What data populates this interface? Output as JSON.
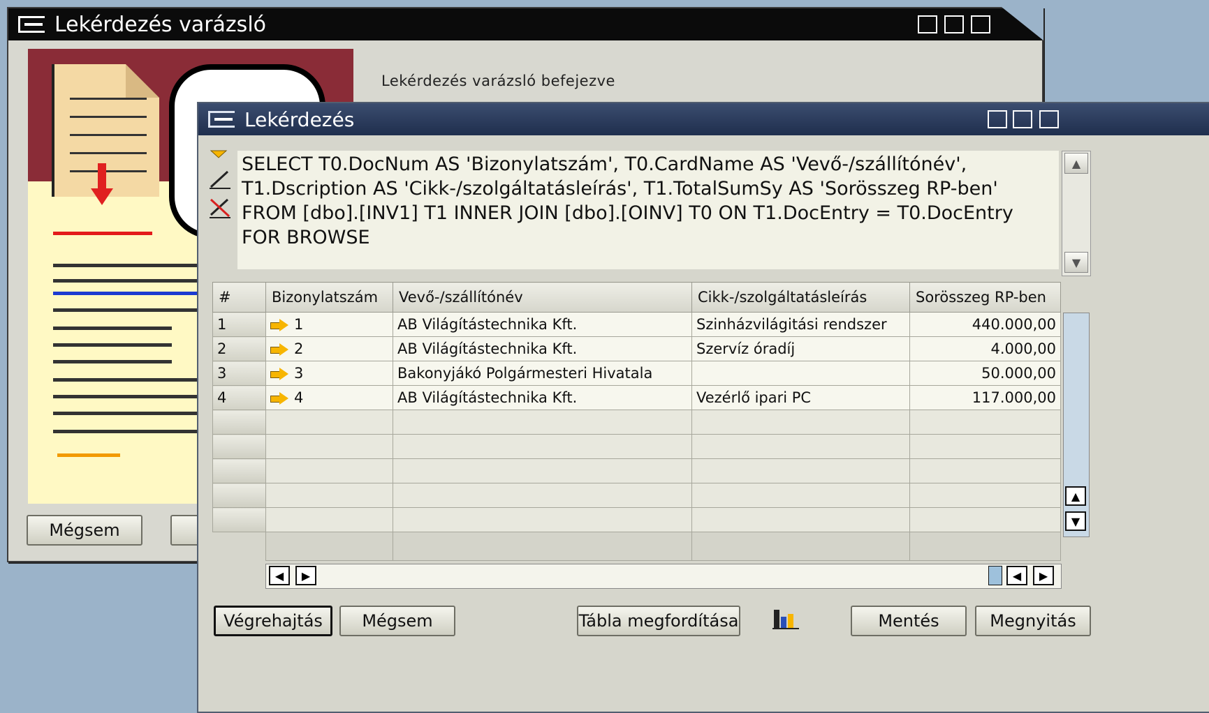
{
  "wizard": {
    "title": "Lekérdezés varázsló",
    "status_text": "Lekérdezés varázsló befejezve",
    "cancel_button": "Mégsem"
  },
  "query": {
    "title": "Lekérdezés",
    "sql": "SELECT T0.DocNum AS 'Bizonylatszám', T0.CardName AS 'Vevő-/szállítónév', T1.Dscription AS 'Cikk-/szolgáltatásleírás', T1.TotalSumSy AS 'Sorösszeg RP-ben' FROM  [dbo].[INV1] T1 INNER JOIN [dbo].[OINV] T0 ON T1.DocEntry = T0.DocEntry FOR BROWSE",
    "columns": [
      "#",
      "Bizonylatszám",
      "Vevő-/szállítónév",
      "Cikk-/szolgáltatásleírás",
      "Sorösszeg RP-ben"
    ],
    "rows": [
      {
        "n": "1",
        "doc": "1",
        "name": "AB Világítástechnika Kft.",
        "desc": "Szinházvilágitási rendszer",
        "sum": "440.000,00"
      },
      {
        "n": "2",
        "doc": "2",
        "name": "AB Világítástechnika Kft.",
        "desc": "Szervíz óradíj",
        "sum": "4.000,00"
      },
      {
        "n": "3",
        "doc": "3",
        "name": "Bakonyjákó Polgármesteri Hivatala",
        "desc": "",
        "sum": "50.000,00"
      },
      {
        "n": "4",
        "doc": "4",
        "name": "AB Világítástechnika Kft.",
        "desc": "Vezérlő ipari PC",
        "sum": "117.000,00"
      }
    ],
    "buttons": {
      "execute": "Végrehajtás",
      "cancel": "Mégsem",
      "transpose": "Tábla megfordítása",
      "save": "Mentés",
      "open": "Megnyitás"
    }
  },
  "colors": {
    "query_titlebar": "#2b3c5e",
    "wizard_titlebar": "#0b0b0b",
    "desktop": "#9bb3c9"
  },
  "icons": [
    "collapse-arrow-icon",
    "pencil-icon",
    "pencil-cancel-icon",
    "chart-icon",
    "link-arrow-icon"
  ]
}
